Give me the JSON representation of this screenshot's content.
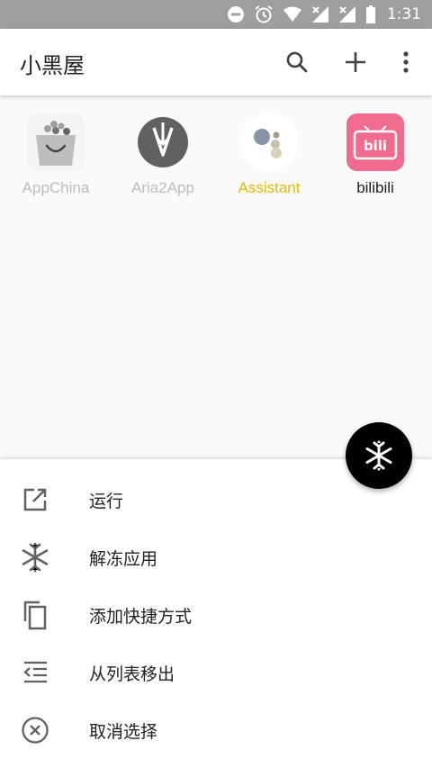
{
  "status_bar": {
    "time": "1:31",
    "icons": [
      "do-not-disturb-icon",
      "alarm-icon",
      "wifi-icon",
      "signal-icon",
      "signal-icon",
      "battery-icon"
    ]
  },
  "app_bar": {
    "title": "小黑屋",
    "actions": [
      "search-icon",
      "add-icon",
      "more-vert-icon"
    ]
  },
  "apps": [
    {
      "label": "AppChina",
      "label_color": "#bdbdbd",
      "icon": "appchina-icon"
    },
    {
      "label": "Aria2App",
      "label_color": "#bdbdbd",
      "icon": "aria2app-icon"
    },
    {
      "label": "Assistant",
      "label_color": "#e6b800",
      "icon": "assistant-icon"
    },
    {
      "label": "bilibili",
      "label_color": "#212121",
      "icon": "bilibili-icon"
    }
  ],
  "fab": {
    "icon": "snowflake-icon"
  },
  "bottom_sheet": {
    "items": [
      {
        "label": "运行",
        "icon": "launch-icon"
      },
      {
        "label": "解冻应用",
        "icon": "unfreeze-icon"
      },
      {
        "label": "添加快捷方式",
        "icon": "copy-shortcut-icon"
      },
      {
        "label": "从列表移出",
        "icon": "remove-from-list-icon"
      },
      {
        "label": "取消选择",
        "icon": "cancel-icon"
      }
    ]
  }
}
